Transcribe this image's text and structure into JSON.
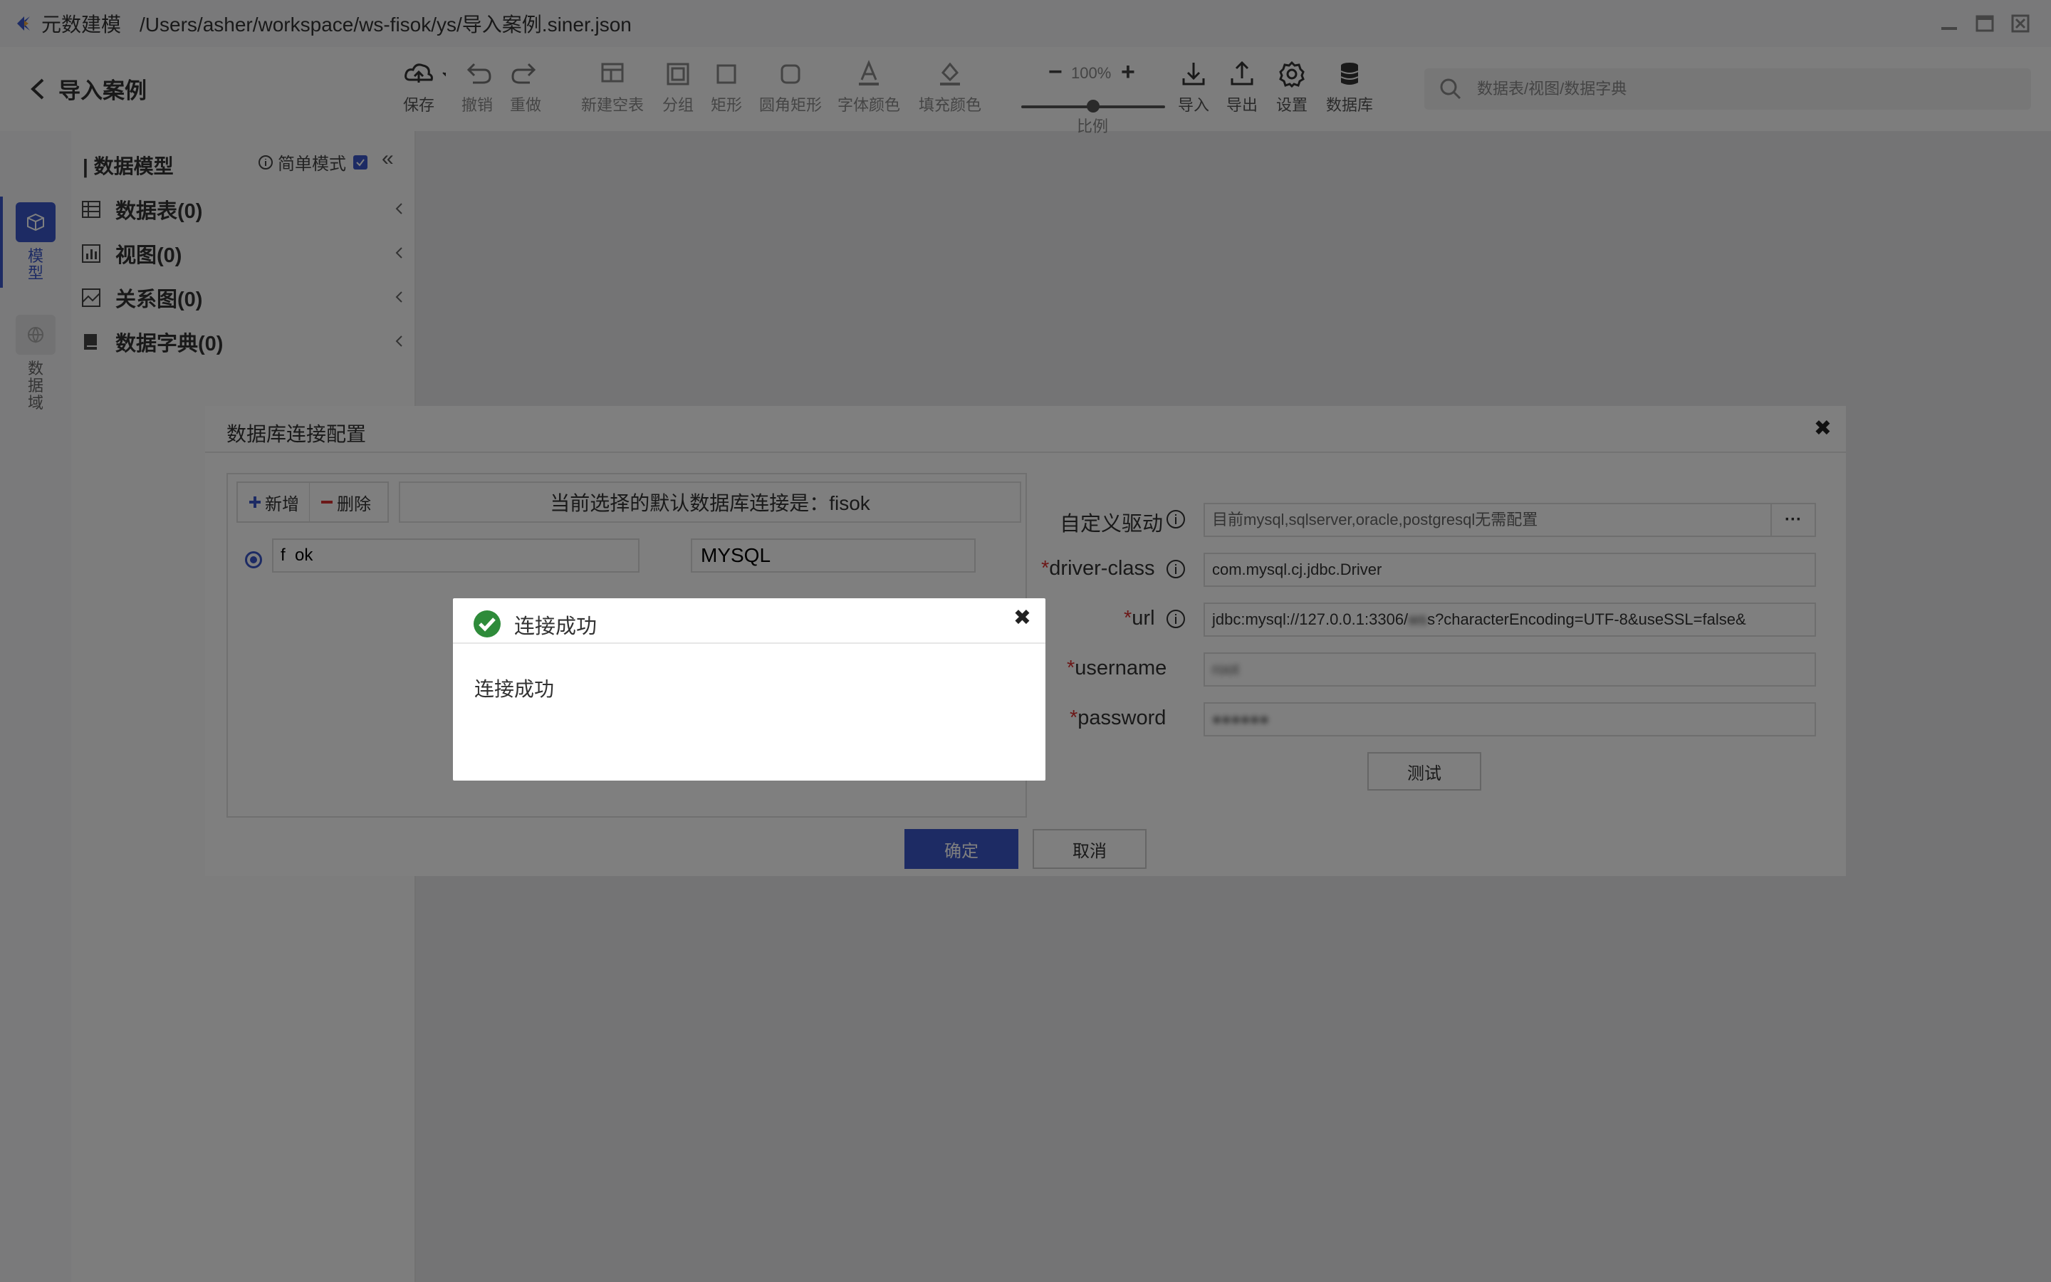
{
  "window": {
    "app_name": "元数建模",
    "file_path": "/Users/asher/workspace/ws-fisok/ys/导入案例.siner.json"
  },
  "header": {
    "back_label": "导入案例"
  },
  "toolbar": {
    "save": "保存",
    "undo": "撤销",
    "redo": "重做",
    "new_table": "新建空表",
    "group": "分组",
    "rect": "矩形",
    "rounded_rect": "圆角矩形",
    "font_color": "字体颜色",
    "fill_color": "填充颜色",
    "zoom_value": "100%",
    "zoom_label": "比例",
    "import": "导入",
    "export": "导出",
    "settings": "设置",
    "database": "数据库",
    "search_placeholder": "数据表/视图/数据字典"
  },
  "rail": {
    "model": "模型",
    "data_domain": "数据域"
  },
  "panel": {
    "title": "数据模型",
    "simple_mode": "简单模式",
    "simple_mode_checked": true,
    "items": [
      {
        "label": "数据表(0)",
        "icon": "table-icon"
      },
      {
        "label": "视图(0)",
        "icon": "view-icon"
      },
      {
        "label": "关系图(0)",
        "icon": "diagram-icon"
      },
      {
        "label": "数据字典(0)",
        "icon": "book-icon"
      }
    ]
  },
  "db_dialog": {
    "title": "数据库连接配置",
    "add": "新增",
    "delete": "删除",
    "default_connection": "当前选择的默认数据库连接是：fisok",
    "connection_name": "f  ok",
    "connection_type": "MYSQL",
    "custom_driver_label": "自定义驱动",
    "custom_driver_placeholder": "目前mysql,sqlserver,oracle,postgresql无需配置",
    "more": "···",
    "driver_class_label": "driver-class",
    "driver_class_value": "com.mysql.cj.jdbc.Driver",
    "url_label": "url",
    "url_prefix": "jdbc:mysql://127.0.0.1:3306/",
    "url_suffix": "s?characterEncoding=UTF-8&useSSL=false&",
    "username_label": "username",
    "password_label": "password",
    "test": "测试",
    "ok": "确定",
    "cancel": "取消"
  },
  "popup": {
    "title": "连接成功",
    "message": "连接成功"
  },
  "colors": {
    "accent": "#3a57c8",
    "success": "#2e8b3a",
    "danger": "#d83030"
  }
}
